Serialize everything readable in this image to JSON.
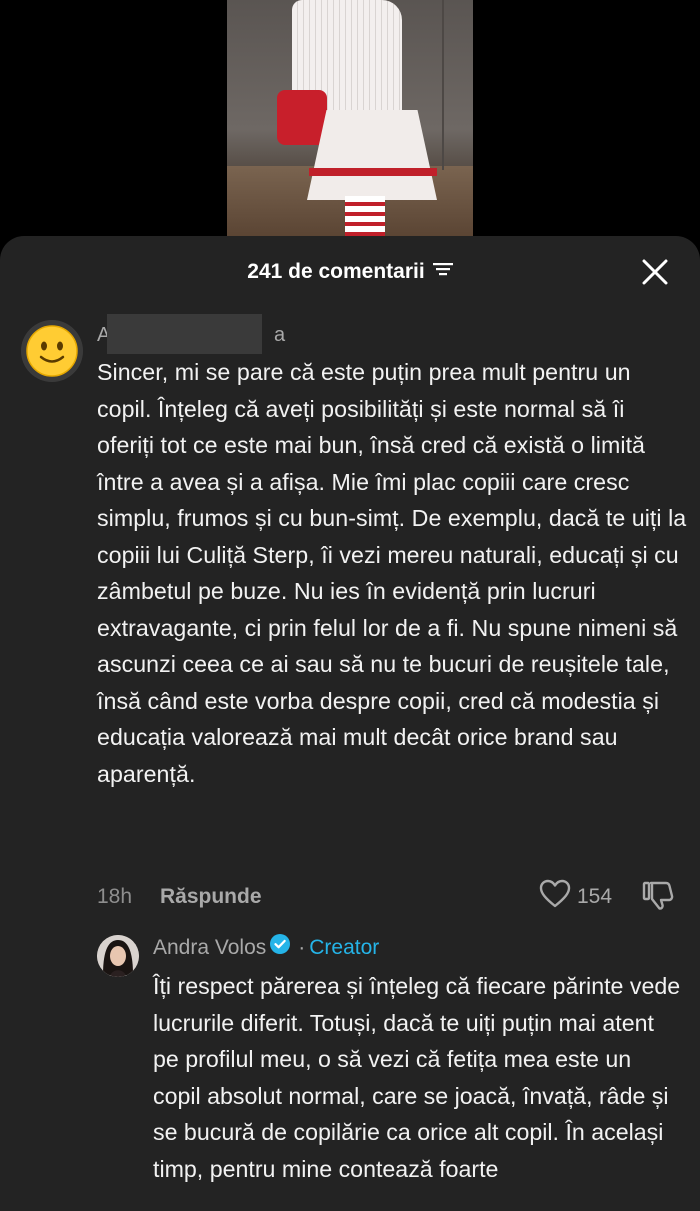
{
  "sheet": {
    "title": "241 de comentarii",
    "filter_icon": "filter-lines-icon",
    "close_icon": "close-icon"
  },
  "comments": [
    {
      "username_start": "A",
      "username_end": "a",
      "avatar_icon": "smiley-emoji-avatar",
      "text": "Sincer, mi se pare că este puțin prea mult pentru un copil. Înțeleg că aveți posibilități și este normal să îi oferiți tot ce este mai bun, însă cred că există o limită între a avea și a afișa. Mie îmi plac copiii care cresc simplu, frumos și cu bun-simț. De exemplu, dacă te uiți la copiii lui Culiță Sterp, îi vezi mereu naturali, educați și cu zâmbetul pe buze. Nu ies în evidență prin lucruri extravagante, ci prin felul lor de a fi. Nu spune nimeni să ascunzi ceea ce ai sau să nu te bucuri de reușitele tale, însă când este vorba despre copii, cred că modestia și educația valorează mai mult decât orice brand sau aparență.",
      "time": "18h",
      "reply_label": "Răspunde",
      "likes": "154"
    },
    {
      "username": "Andra Volos",
      "separator": "·",
      "badge": "Creator",
      "text": "Îți respect părerea și înțeleg că fiecare părinte vede lucrurile diferit. Totuși, dacă te uiți puțin mai atent pe profilul meu, o să vezi că fetița mea este un copil absolut normal, care se joacă, învață, râde și se bucură de copilărie ca orice alt copil. În același timp, pentru mine contează foarte"
    }
  ],
  "colors": {
    "sheet_bg": "#232323",
    "creator_accent": "#25b4e8",
    "muted_text": "#a9a9a9"
  }
}
